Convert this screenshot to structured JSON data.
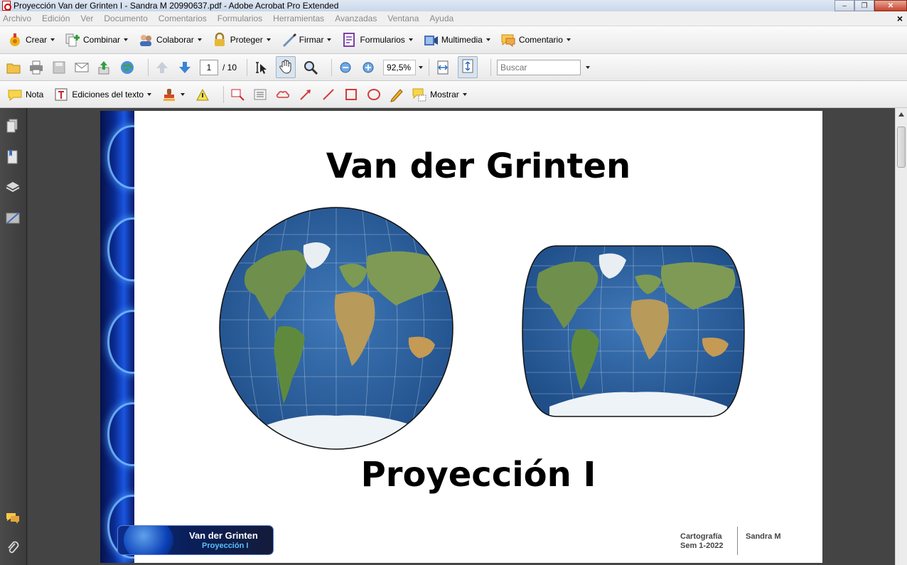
{
  "window": {
    "title": "Proyección Van der Grinten I - Sandra M 20990637.pdf - Adobe Acrobat Pro Extended",
    "minimize_label": "–",
    "maximize_label": "❐",
    "close_label": "✕"
  },
  "menubar": {
    "items": [
      "Archivo",
      "Edición",
      "Ver",
      "Documento",
      "Comentarios",
      "Formularios",
      "Herramientas",
      "Avanzadas",
      "Ventana",
      "Ayuda"
    ],
    "doc_close": "×"
  },
  "toolbar_tasks": {
    "buttons": [
      {
        "label": "Crear",
        "icon": "create-pdf-icon"
      },
      {
        "label": "Combinar",
        "icon": "combine-icon"
      },
      {
        "label": "Colaborar",
        "icon": "collaborate-icon"
      },
      {
        "label": "Proteger",
        "icon": "lock-icon"
      },
      {
        "label": "Firmar",
        "icon": "pen-icon"
      },
      {
        "label": "Formularios",
        "icon": "forms-icon"
      },
      {
        "label": "Multimedia",
        "icon": "multimedia-icon"
      },
      {
        "label": "Comentario",
        "icon": "comment-icon"
      }
    ]
  },
  "toolbar_nav": {
    "page_current": "1",
    "page_total": "/ 10",
    "zoom_value": "92,5%",
    "search_placeholder": "Buscar"
  },
  "toolbar_comment": {
    "note_label": "Nota",
    "text_edits_label": "Ediciones del texto",
    "show_label": "Mostrar"
  },
  "document": {
    "title": "Van der Grinten",
    "subtitle": "Proyección I",
    "footer_banner_title": "Van der Grinten",
    "footer_banner_subtitle": "Proyección I",
    "footer_course": "Cartografía",
    "footer_semester": "Sem 1-2022",
    "footer_author": "Sandra M"
  },
  "colors": {
    "accent_blue": "#1a55e0",
    "ocean": "#2b5d9a",
    "land": "#6d8f4a",
    "ice": "#eef3f7"
  }
}
